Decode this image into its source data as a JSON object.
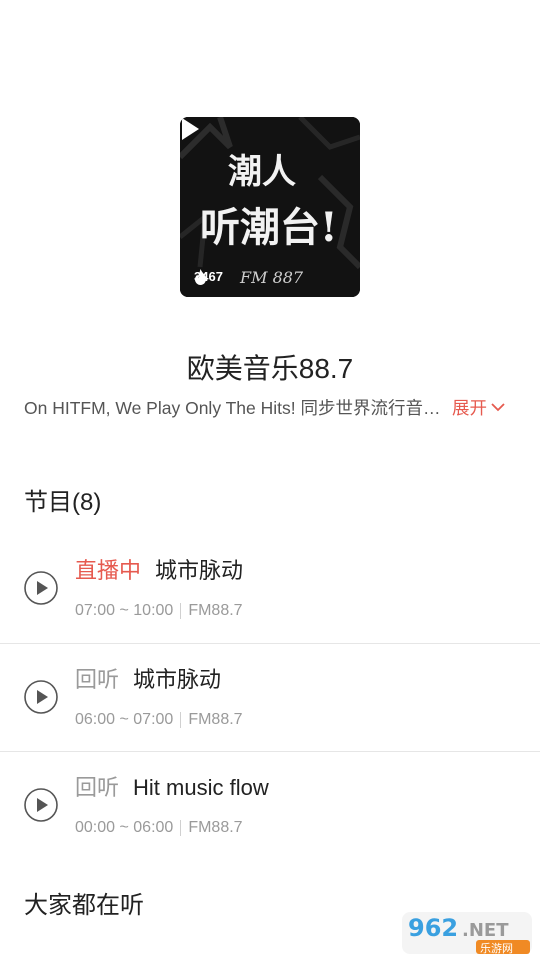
{
  "cover": {
    "art_line1": "潮人",
    "art_line2": "听潮台!",
    "art_sub": "FM 887",
    "listen_count": "3467"
  },
  "station": {
    "title": "欧美音乐88.7",
    "description": "On HITFM, We Play Only The Hits! 同步世界流行音乐榜单，带你聆听最热的欧美金曲",
    "expand_label": "展开"
  },
  "programs": {
    "title": "节目(8)",
    "items": [
      {
        "tag": "直播中",
        "live": true,
        "name": "城市脉动",
        "time": "07:00 ~ 10:00",
        "channel": "FM88.7"
      },
      {
        "tag": "回听",
        "live": false,
        "name": "城市脉动",
        "time": "06:00 ~ 07:00",
        "channel": "FM88.7"
      },
      {
        "tag": "回听",
        "live": false,
        "name": "Hit music flow",
        "time": "00:00 ~ 06:00",
        "channel": "FM88.7"
      }
    ]
  },
  "others": {
    "title": "大家都在听"
  },
  "watermark": {
    "top": "962",
    "dot": ".NET",
    "bottom": "乐游网"
  },
  "colors": {
    "accent": "#e65a4f",
    "muted": "#9a9a9a",
    "text": "#222222"
  },
  "icons": [
    "play-icon",
    "flame-icon",
    "chevron-down-icon",
    "play-circle-icon"
  ]
}
